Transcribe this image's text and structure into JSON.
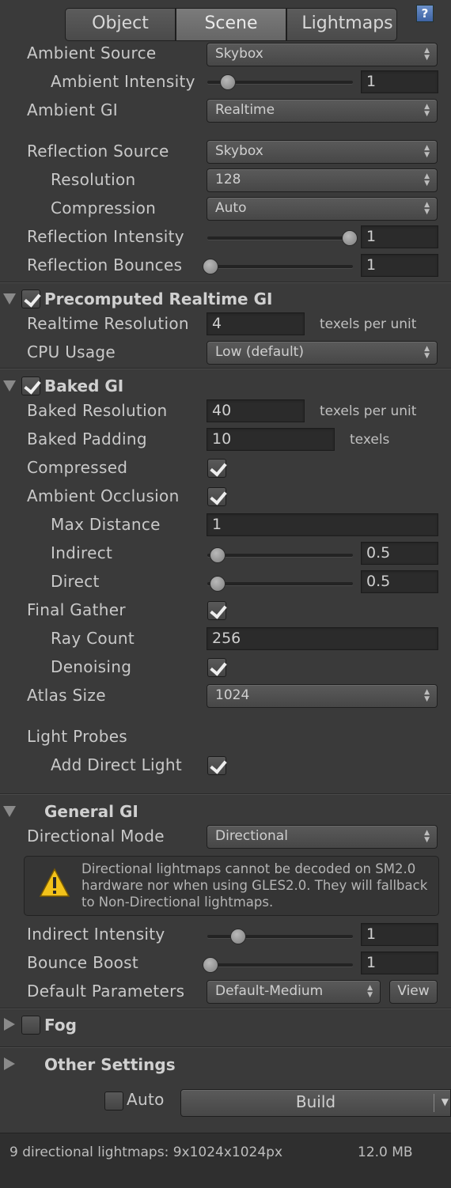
{
  "tabs": {
    "object": "Object",
    "scene": "Scene",
    "lightmaps": "Lightmaps"
  },
  "environment": {
    "ambient_source": {
      "label": "Ambient Source",
      "value": "Skybox"
    },
    "ambient_intensity": {
      "label": "Ambient Intensity",
      "value": "1",
      "slider_fraction": 0.125
    },
    "ambient_gi": {
      "label": "Ambient GI",
      "value": "Realtime"
    },
    "reflection_source": {
      "label": "Reflection Source",
      "value": "Skybox"
    },
    "resolution": {
      "label": "Resolution",
      "value": "128"
    },
    "compression": {
      "label": "Compression",
      "value": "Auto"
    },
    "reflection_intensity": {
      "label": "Reflection Intensity",
      "value": "1",
      "slider_fraction": 1.0
    },
    "reflection_bounces": {
      "label": "Reflection Bounces",
      "value": "1",
      "slider_fraction": 0.0
    }
  },
  "precomputed": {
    "title": "Precomputed Realtime GI",
    "enabled": true,
    "realtime_resolution": {
      "label": "Realtime Resolution",
      "value": "4",
      "unit": "texels per unit"
    },
    "cpu_usage": {
      "label": "CPU Usage",
      "value": "Low (default)"
    }
  },
  "baked": {
    "title": "Baked GI",
    "enabled": true,
    "baked_resolution": {
      "label": "Baked Resolution",
      "value": "40",
      "unit": "texels per unit"
    },
    "baked_padding": {
      "label": "Baked Padding",
      "value": "10",
      "unit": "texels"
    },
    "compressed": {
      "label": "Compressed",
      "checked": true
    },
    "ambient_occlusion": {
      "label": "Ambient Occlusion",
      "checked": true
    },
    "max_distance": {
      "label": "Max Distance",
      "value": "1"
    },
    "indirect": {
      "label": "Indirect",
      "value": "0.5",
      "slider_fraction": 0.05
    },
    "direct": {
      "label": "Direct",
      "value": "0.5",
      "slider_fraction": 0.05
    },
    "final_gather": {
      "label": "Final Gather",
      "checked": true
    },
    "ray_count": {
      "label": "Ray Count",
      "value": "256"
    },
    "denoising": {
      "label": "Denoising",
      "checked": true
    },
    "atlas_size": {
      "label": "Atlas Size",
      "value": "1024"
    },
    "light_probes": {
      "label": "Light Probes"
    },
    "add_direct_light": {
      "label": "Add Direct Light",
      "checked": true
    }
  },
  "general": {
    "title": "General GI",
    "directional_mode": {
      "label": "Directional Mode",
      "value": "Directional"
    },
    "warning": "Directional lightmaps cannot be decoded on SM2.0 hardware nor when using GLES2.0. They will fallback to Non-Directional lightmaps.",
    "indirect_intensity": {
      "label": "Indirect Intensity",
      "value": "1",
      "slider_fraction": 0.2
    },
    "bounce_boost": {
      "label": "Bounce Boost",
      "value": "1",
      "slider_fraction": 0.0
    },
    "default_parameters": {
      "label": "Default Parameters",
      "value": "Default-Medium",
      "view": "View"
    }
  },
  "fog": {
    "title": "Fog",
    "enabled": false
  },
  "other": {
    "title": "Other Settings"
  },
  "build": {
    "auto_label": "Auto",
    "auto_checked": false,
    "build_label": "Build"
  },
  "footer": {
    "summary": "9 directional lightmaps: 9x1024x1024px",
    "size": "12.0 MB"
  },
  "colors": {
    "background": "#3a3a3a",
    "warning": "#f2c21a"
  }
}
